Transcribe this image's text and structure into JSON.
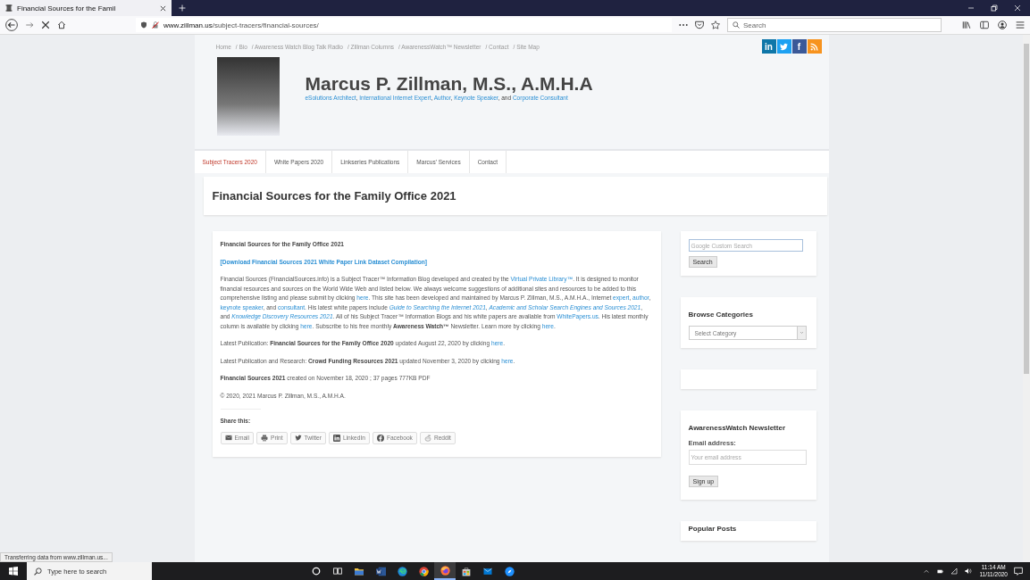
{
  "browser": {
    "tabs": [
      {
        "title": "Financial Sources for the Famil",
        "selected": true
      }
    ],
    "url_domain": "www.zillman.us",
    "url_path": "/subject-tracers/financial-sources/",
    "search_placeholder": "Search"
  },
  "page": {
    "top_links": [
      "Home",
      "/ Bio",
      "/ Awareness Watch Blog Talk Radio",
      "/ Zillman Columns",
      "/ AwarenessWatch™ Newsletter",
      "/ Contact",
      "/ Site Map"
    ],
    "social": [
      {
        "kind": "text",
        "label": "in",
        "color": "#0e76a8"
      },
      {
        "kind": "bird",
        "color": "#1da1f2"
      },
      {
        "kind": "text",
        "label": "f",
        "color": "#3b5998"
      },
      {
        "kind": "rss",
        "color": "#f7931e"
      }
    ],
    "site_title": "Marcus P. Zillman, M.S., A.M.H.A",
    "tagline": [
      {
        "text": "eSolutions Architect",
        "kind": "link"
      },
      {
        "text": ", ",
        "kind": "plain"
      },
      {
        "text": "International Internet Expert",
        "kind": "link"
      },
      {
        "text": ", ",
        "kind": "plain"
      },
      {
        "text": "Author",
        "kind": "link"
      },
      {
        "text": ", ",
        "kind": "plain"
      },
      {
        "text": "Keynote Speaker",
        "kind": "link"
      },
      {
        "text": ", and ",
        "kind": "plain"
      },
      {
        "text": "Corporate Consultant",
        "kind": "link"
      }
    ],
    "nav": [
      {
        "label": "Subject Tracers 2020",
        "selected": true
      },
      {
        "label": "White Papers 2020",
        "selected": false
      },
      {
        "label": "Linkseries Publications",
        "selected": false
      },
      {
        "label": "Marcus' Services",
        "selected": false
      },
      {
        "label": "Contact",
        "selected": false
      }
    ],
    "page_title": "Financial Sources for the Family Office 2021",
    "article": {
      "paragraphs": [
        [
          {
            "text": "Financial Sources for the Family Office 2021",
            "kind": "bold"
          }
        ],
        [
          {
            "text": "[Download Financial Sources 2021 White Paper Link Dataset Compilation]",
            "kind": "blink"
          }
        ],
        [
          {
            "text": "Financial Sources (FinancialSources.info) is a Subject Tracer™ Information Blog developed and created by the ",
            "kind": "plain"
          },
          {
            "text": "Virtual Private Library™",
            "kind": "link"
          },
          {
            "text": ". It is designed to monitor financial resources and sources on the World Wide Web and listed below. We always welcome suggestions of additional sites and resources to be added to this comprehensive listing and please submit by clicking ",
            "kind": "plain"
          },
          {
            "text": "here",
            "kind": "link"
          },
          {
            "text": ". This site has been developed and maintained by Marcus P. Zillman, M.S., A.M.H.A., Internet ",
            "kind": "plain"
          },
          {
            "text": "expert",
            "kind": "link"
          },
          {
            "text": ", ",
            "kind": "plain"
          },
          {
            "text": "author",
            "kind": "link"
          },
          {
            "text": ", ",
            "kind": "plain"
          },
          {
            "text": "keynote speaker",
            "kind": "link"
          },
          {
            "text": ", and ",
            "kind": "plain"
          },
          {
            "text": "consultant",
            "kind": "link"
          },
          {
            "text": ". His latest white papers include ",
            "kind": "plain"
          },
          {
            "text": "Guide to Searching the Internet 2021",
            "kind": "ilink"
          },
          {
            "text": ",  ",
            "kind": "plain"
          },
          {
            "text": "Academic and Scholar Search Engines and Sources 2021",
            "kind": "ilink"
          },
          {
            "text": ", and ",
            "kind": "plain"
          },
          {
            "text": "Knowledge Discovery Resources 2021",
            "kind": "ilink"
          },
          {
            "text": ". All of his Subject Tracer™ Information Blogs and his white papers are available from ",
            "kind": "plain"
          },
          {
            "text": "WhitePapers.us",
            "kind": "link"
          },
          {
            "text": ".  His latest monthly column is available by clicking ",
            "kind": "plain"
          },
          {
            "text": "here",
            "kind": "link"
          },
          {
            "text": ". Subscribe to his free monthly ",
            "kind": "plain"
          },
          {
            "text": "Awareness Watch™",
            "kind": "bold"
          },
          {
            "text": " Newsletter. Learn more by clicking ",
            "kind": "plain"
          },
          {
            "text": "here",
            "kind": "link"
          },
          {
            "text": ".",
            "kind": "plain"
          }
        ],
        [
          {
            "text": "Latest Publication: ",
            "kind": "plain"
          },
          {
            "text": "Financial Sources for the Family Office 2020",
            "kind": "bold"
          },
          {
            "text": " updated August 22, 2020 by clicking ",
            "kind": "plain"
          },
          {
            "text": "here",
            "kind": "link"
          },
          {
            "text": ".",
            "kind": "plain"
          }
        ],
        [
          {
            "text": "Latest Publication and Research: ",
            "kind": "plain"
          },
          {
            "text": "Crowd Funding Resources 2021",
            "kind": "bold"
          },
          {
            "text": " updated November 3, 2020 by clicking ",
            "kind": "plain"
          },
          {
            "text": "here",
            "kind": "link"
          },
          {
            "text": ".",
            "kind": "plain"
          }
        ],
        [
          {
            "text": "Financial Sources 2021",
            "kind": "bold"
          },
          {
            "text": " created on November 18, 2020 ; 37 pages 777KB PDF",
            "kind": "plain"
          }
        ],
        [
          {
            "text": "© 2020, 2021 Marcus P. Zillman, M.S., A.M.H.A.",
            "kind": "plain"
          }
        ]
      ],
      "share_title": "Share this:",
      "share": [
        {
          "kind": "email",
          "label": "Email"
        },
        {
          "kind": "print",
          "label": "Print"
        },
        {
          "kind": "bird",
          "label": "Twitter"
        },
        {
          "kind": "in",
          "label": "LinkedIn"
        },
        {
          "kind": "f",
          "label": "Facebook"
        },
        {
          "kind": "reddit",
          "label": "Reddit"
        }
      ]
    },
    "sidebar": {
      "search": {
        "placeholder": "Google Custom Search",
        "button": "Search"
      },
      "categories": {
        "title": "Browse Categories",
        "select": "Select Category"
      },
      "newsletter": {
        "title": "AwarenessWatch Newsletter",
        "label": "Email address:",
        "placeholder": "Your email address",
        "button": "Sign up"
      },
      "popular_title": "Popular Posts"
    }
  },
  "status_text": "Transferring data from www.zillman.us...",
  "taskbar": {
    "search_placeholder": "Type here to search",
    "apps": [
      {
        "kind": "cortana",
        "selected": false
      },
      {
        "kind": "taskview",
        "selected": false
      },
      {
        "kind": "folder",
        "selected": false
      },
      {
        "kind": "word",
        "selected": false
      },
      {
        "kind": "edge",
        "selected": false
      },
      {
        "kind": "chrome",
        "selected": false
      },
      {
        "kind": "firefox",
        "selected": true
      },
      {
        "kind": "store",
        "selected": false
      },
      {
        "kind": "mail",
        "selected": false
      },
      {
        "kind": "compass",
        "selected": false
      }
    ],
    "time": "11:14 AM",
    "date": "11/11/2020"
  }
}
